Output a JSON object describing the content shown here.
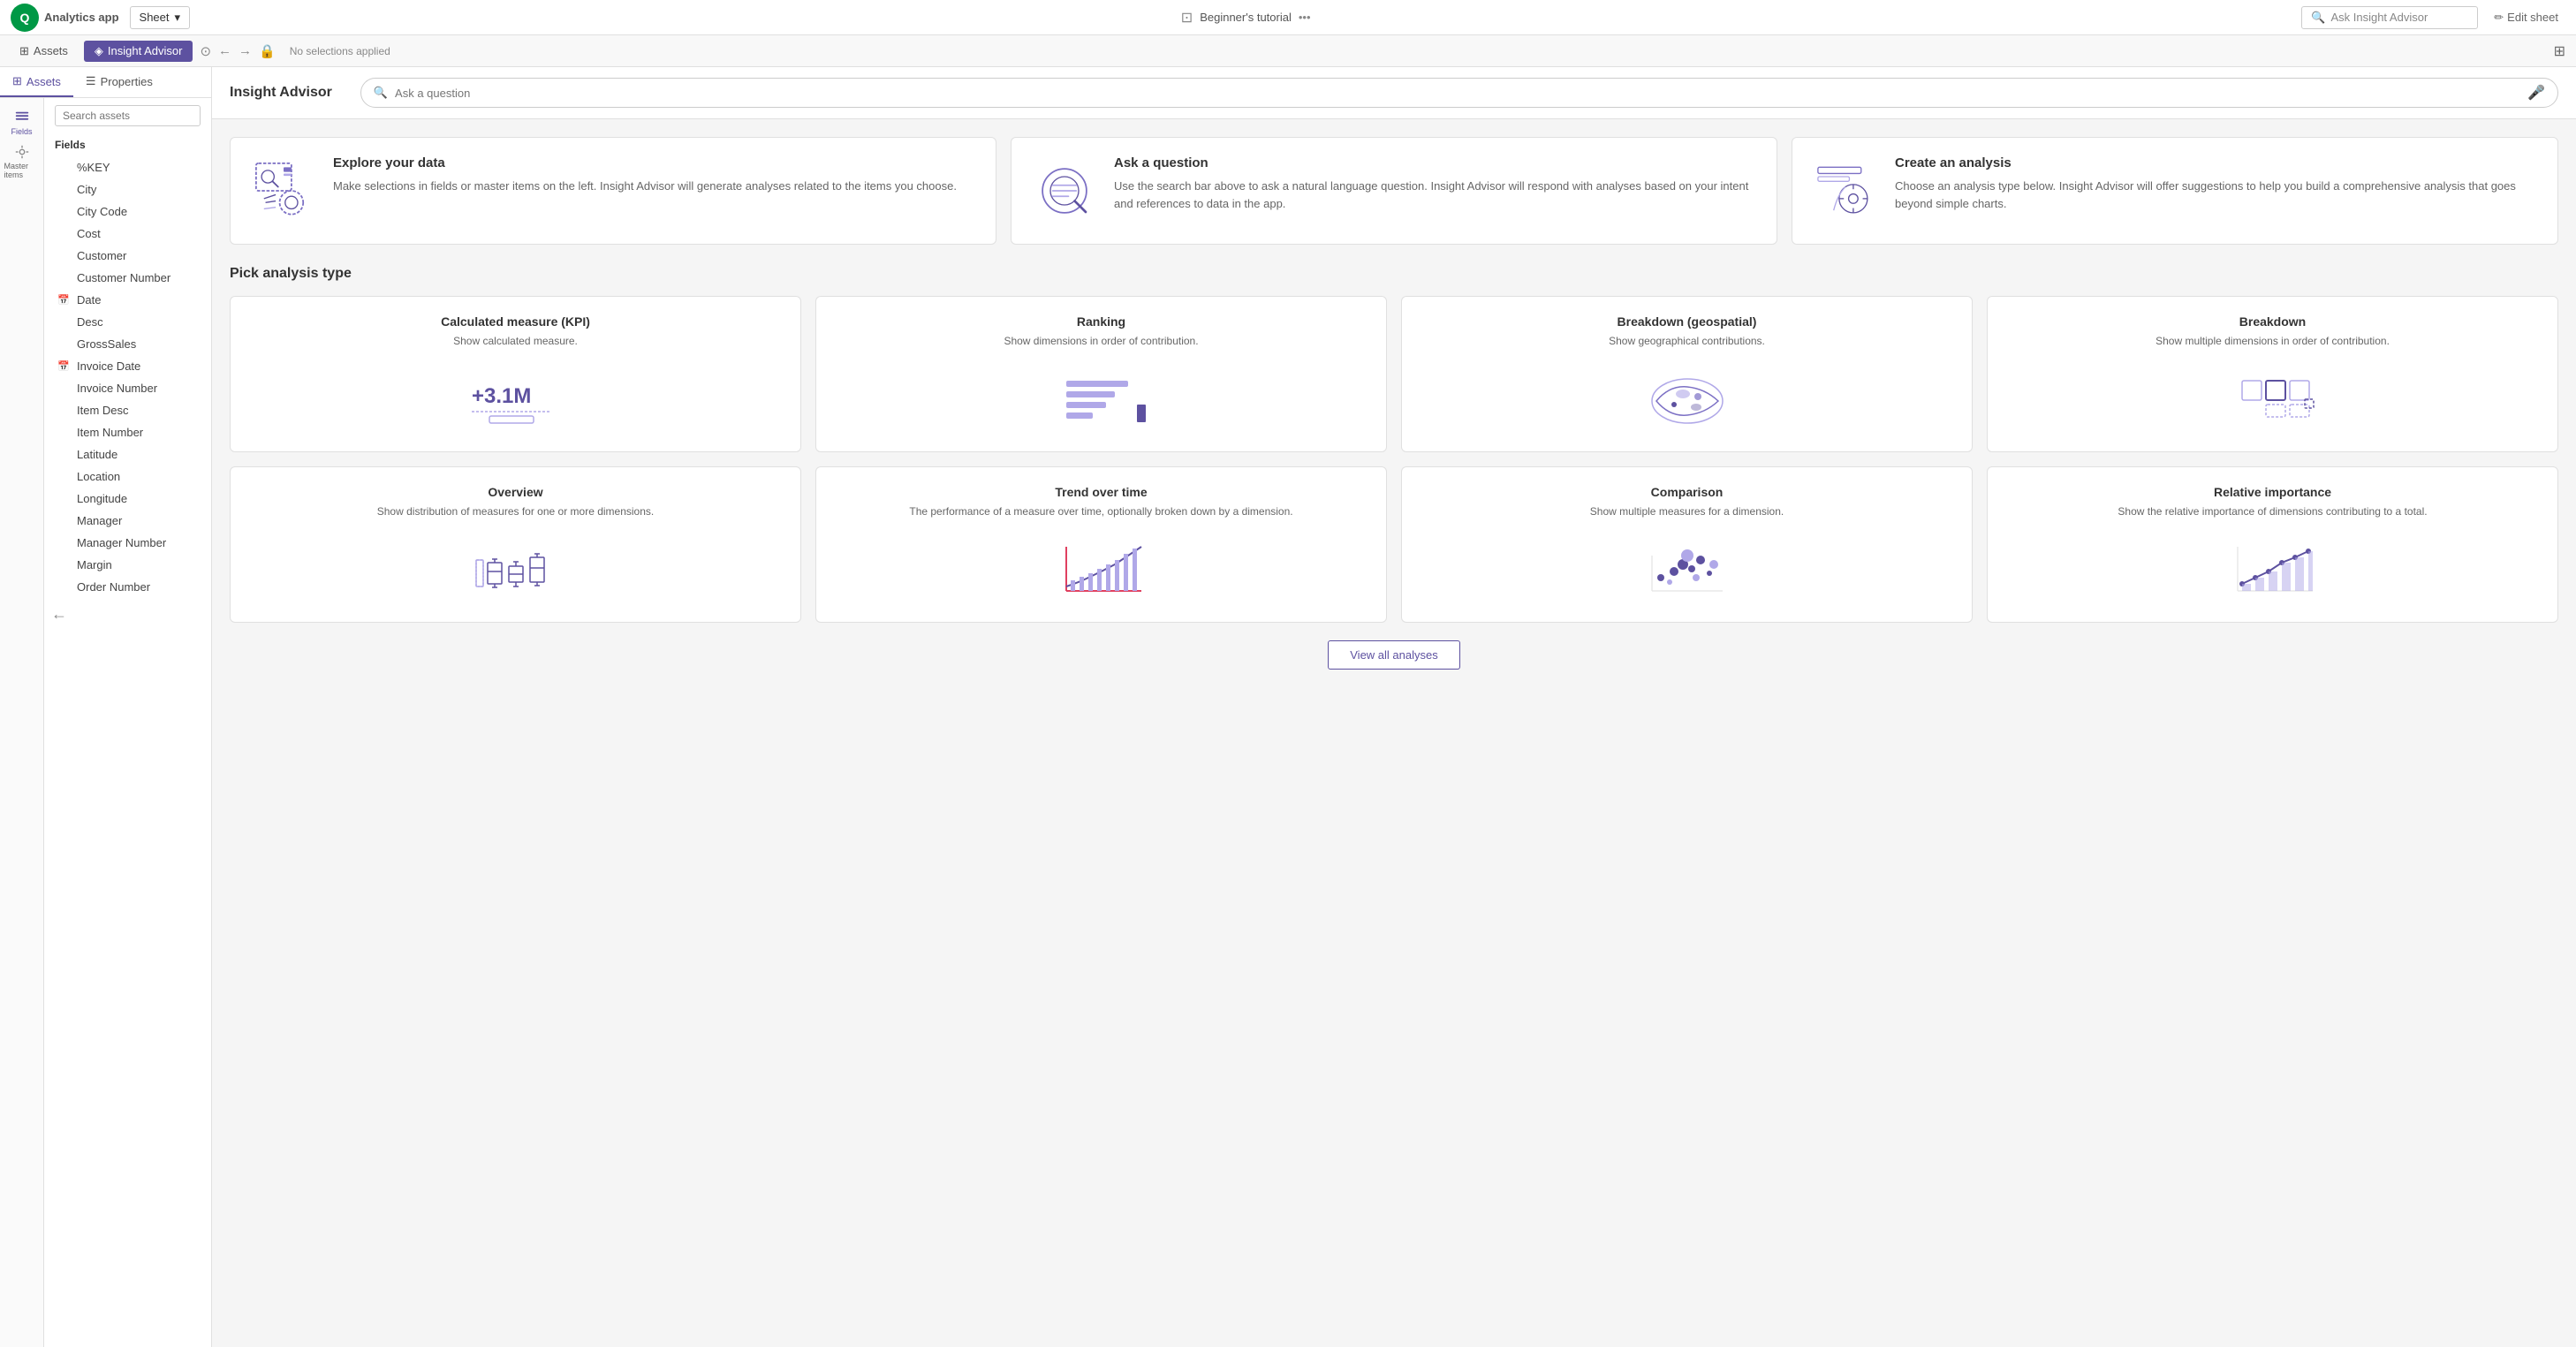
{
  "app": {
    "logo_text": "Q",
    "name": "Analytics app",
    "sheet_dropdown": "Sheet",
    "tutorial": "Beginner's tutorial",
    "search_top_placeholder": "Ask Insight Advisor",
    "edit_sheet": "Edit sheet"
  },
  "toolbar": {
    "assets_label": "Assets",
    "insight_advisor_label": "Insight Advisor",
    "no_selections": "No selections applied"
  },
  "panel": {
    "assets_tab": "Assets",
    "properties_tab": "Properties",
    "search_placeholder": "Search assets",
    "fields_title": "Fields",
    "fields": [
      {
        "name": "%KEY",
        "type": "text"
      },
      {
        "name": "City",
        "type": "text"
      },
      {
        "name": "City Code",
        "type": "text"
      },
      {
        "name": "Cost",
        "type": "text"
      },
      {
        "name": "Customer",
        "type": "text"
      },
      {
        "name": "Customer Number",
        "type": "text"
      },
      {
        "name": "Date",
        "type": "date"
      },
      {
        "name": "Desc",
        "type": "text"
      },
      {
        "name": "GrossSales",
        "type": "text"
      },
      {
        "name": "Invoice Date",
        "type": "date"
      },
      {
        "name": "Invoice Number",
        "type": "text"
      },
      {
        "name": "Item Desc",
        "type": "text"
      },
      {
        "name": "Item Number",
        "type": "text"
      },
      {
        "name": "Latitude",
        "type": "text"
      },
      {
        "name": "Location",
        "type": "text"
      },
      {
        "name": "Longitude",
        "type": "text"
      },
      {
        "name": "Manager",
        "type": "text"
      },
      {
        "name": "Manager Number",
        "type": "text"
      },
      {
        "name": "Margin",
        "type": "text"
      },
      {
        "name": "Order Number",
        "type": "text"
      }
    ]
  },
  "insight_advisor": {
    "title": "Insight Advisor",
    "search_placeholder": "Ask a question"
  },
  "top_cards": [
    {
      "id": "explore",
      "title": "Explore your data",
      "description": "Make selections in fields or master items on the left. Insight Advisor will generate analyses related to the items you choose."
    },
    {
      "id": "ask",
      "title": "Ask a question",
      "description": "Use the search bar above to ask a natural language question. Insight Advisor will respond with analyses based on your intent and references to data in the app."
    },
    {
      "id": "create",
      "title": "Create an analysis",
      "description": "Choose an analysis type below. Insight Advisor will offer suggestions to help you build a comprehensive analysis that goes beyond simple charts."
    }
  ],
  "analysis_section": {
    "title": "Pick analysis type",
    "cards": [
      {
        "id": "kpi",
        "title": "Calculated measure (KPI)",
        "description": "Show calculated measure.",
        "value": "+3.1M"
      },
      {
        "id": "ranking",
        "title": "Ranking",
        "description": "Show dimensions in order of contribution."
      },
      {
        "id": "breakdown-geo",
        "title": "Breakdown (geospatial)",
        "description": "Show geographical contributions."
      },
      {
        "id": "breakdown",
        "title": "Breakdown",
        "description": "Show multiple dimensions in order of contribution."
      },
      {
        "id": "overview",
        "title": "Overview",
        "description": "Show distribution of measures for one or more dimensions."
      },
      {
        "id": "trend",
        "title": "Trend over time",
        "description": "The performance of a measure over time, optionally broken down by a dimension."
      },
      {
        "id": "comparison",
        "title": "Comparison",
        "description": "Show multiple measures for a dimension."
      },
      {
        "id": "relative",
        "title": "Relative importance",
        "description": "Show the relative importance of dimensions contributing to a total."
      }
    ],
    "view_all_label": "View all analyses"
  }
}
